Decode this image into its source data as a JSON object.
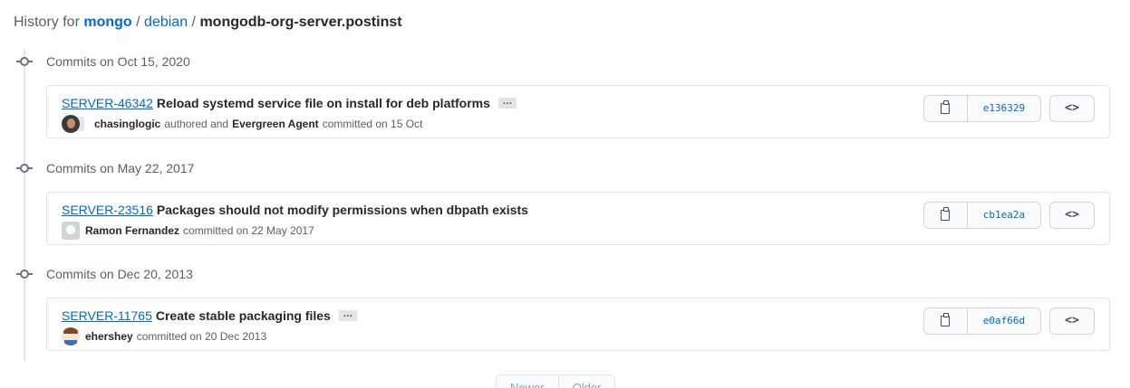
{
  "breadcrumb": {
    "prefix": "History for",
    "repo": "mongo",
    "sep1": "/",
    "folder": "debian",
    "sep2": "/",
    "file": "mongodb-org-server.postinst"
  },
  "groups": [
    {
      "title": "Commits on Oct 15, 2020",
      "commit": {
        "issue": "SERVER-46342",
        "message": "Reload systemd service file on install for deb platforms",
        "has_ellipsis": true,
        "ellipsis": "…",
        "author": "chasinglogic",
        "author_action": "authored and",
        "committer": "Evergreen Agent",
        "commit_text": "committed on 15 Oct",
        "sha": "e136329",
        "avatar_icon": "stacked-avatars"
      }
    },
    {
      "title": "Commits on May 22, 2017",
      "commit": {
        "issue": "SERVER-23516",
        "message": "Packages should not modify permissions when dbpath exists",
        "has_ellipsis": false,
        "author": "Ramon Fernandez",
        "commit_text": "committed on 22 May 2017",
        "sha": "cb1ea2a",
        "avatar_icon": "default-avatar"
      }
    },
    {
      "title": "Commits on Dec 20, 2013",
      "commit": {
        "issue": "SERVER-11765",
        "message": "Create stable packaging files",
        "has_ellipsis": true,
        "ellipsis": "…",
        "author": "ehershey",
        "commit_text": "committed on 20 Dec 2013",
        "sha": "e0af66d",
        "avatar_icon": "user-avatar"
      }
    }
  ],
  "buttons": {
    "browse_label": "<>",
    "copy_icon": "clipboard-icon"
  },
  "pagination": {
    "newer": "Newer",
    "older": "Older"
  },
  "colors": {
    "link": "#0366d6",
    "muted": "#586069",
    "border": "#e1e4e8"
  }
}
